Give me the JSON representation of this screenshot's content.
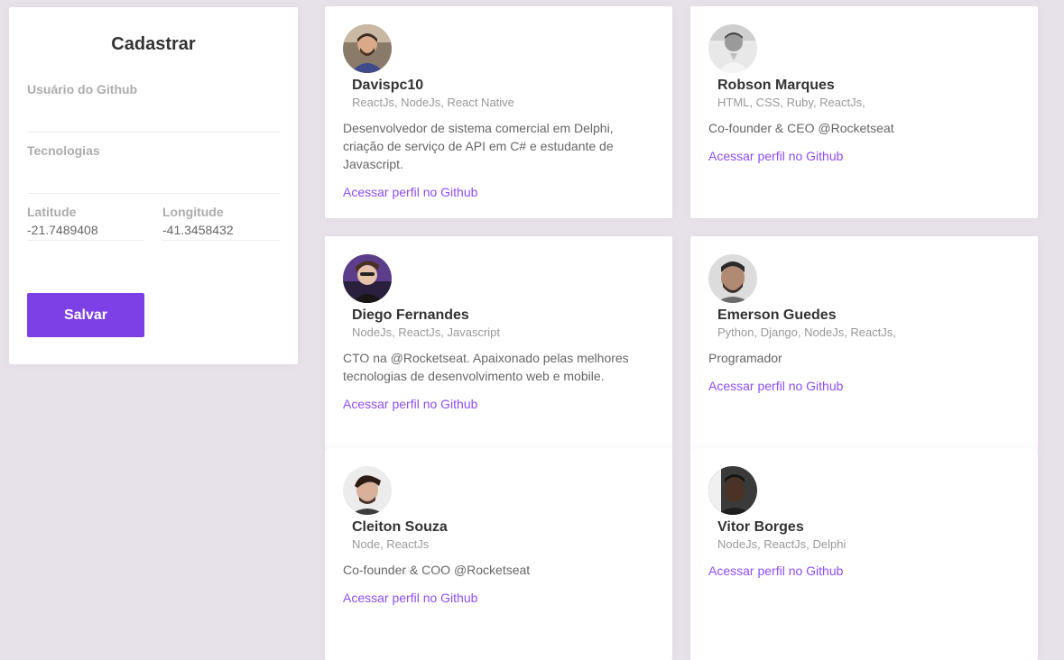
{
  "form": {
    "title": "Cadastrar",
    "github_user_label": "Usuário do Github",
    "github_user_value": "",
    "techs_label": "Tecnologias",
    "techs_value": "",
    "latitude_label": "Latitude",
    "latitude_value": "-21.7489408",
    "longitude_label": "Longitude",
    "longitude_value": "-41.3458432",
    "save_label": "Salvar"
  },
  "colors": {
    "accent": "#7d40e7",
    "link": "#8e4dff",
    "background": "#e7e2ea"
  },
  "devs": [
    {
      "name": "Davispc10",
      "techs": "ReactJs, NodeJs, React Native",
      "bio": "Desenvolvedor de sistema comercial em Delphi, criação de serviço de API em C# e estudante de Javascript.",
      "link": "Acessar perfil no Github"
    },
    {
      "name": "Robson Marques",
      "techs": "HTML, CSS, Ruby, ReactJs,",
      "bio": "Co-founder & CEO @Rocketseat",
      "link": "Acessar perfil no Github"
    },
    {
      "name": "Diego Fernandes",
      "techs": "NodeJs, ReactJs, Javascript",
      "bio": "CTO na @Rocketseat. Apaixonado pelas melhores tecnologias de desenvolvimento web e mobile.",
      "link": "Acessar perfil no Github"
    },
    {
      "name": "Emerson Guedes",
      "techs": "Python, Django, NodeJs, ReactJs,",
      "bio": "Programador",
      "link": "Acessar perfil no Github"
    },
    {
      "name": "Cleiton Souza",
      "techs": "Node, ReactJs",
      "bio": "Co-founder & COO @Rocketseat",
      "link": "Acessar perfil no Github"
    },
    {
      "name": "Vitor Borges",
      "techs": "NodeJs, ReactJs, Delphi",
      "bio": "",
      "link": "Acessar perfil no Github"
    }
  ]
}
